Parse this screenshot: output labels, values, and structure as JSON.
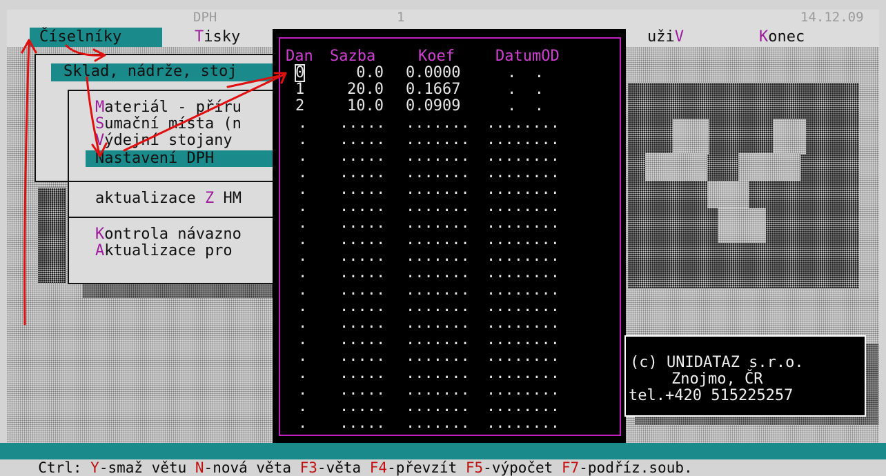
{
  "topbar": {
    "module": "DPH",
    "page": "1",
    "date": "14.12.09"
  },
  "menu": [
    {
      "hot": "",
      "label": "Číselníky",
      "selected": true
    },
    {
      "hot": "T",
      "label": "isky"
    },
    {
      "pre": "uži",
      "hot": "V",
      "label": ""
    },
    {
      "hot": "K",
      "label": "onec"
    }
  ],
  "submenu1": {
    "selected": "Sklad, nádrže, stoj"
  },
  "submenu2": {
    "items": [
      {
        "hot": "M",
        "label": "ateriál - příru"
      },
      {
        "hot": "S",
        "label": "umační místa (n"
      },
      {
        "hot": "V",
        "label": "ýdejní stojany"
      },
      {
        "hot": "",
        "label": "Nastavení DPH",
        "selected": true
      }
    ]
  },
  "submenu3": {
    "pre": "aktualizace ",
    "hot": "Z",
    "label": " HM"
  },
  "submenu4": {
    "items": [
      {
        "hot": "K",
        "label": "ontrola návazno"
      },
      {
        "hot": "A",
        "label": "ktualizace pro"
      }
    ]
  },
  "table": {
    "columns": [
      "Dan",
      "Sazba",
      "Koef",
      "DatumOD"
    ],
    "rows": [
      {
        "dan": "0",
        "sazba": "0.0",
        "koef": "0.0000",
        "datum": ".  ."
      },
      {
        "dan": "1",
        "sazba": "20.0",
        "koef": "0.1667",
        "datum": ".  ."
      },
      {
        "dan": "2",
        "sazba": "10.0",
        "koef": "0.0909",
        "datum": ".  ."
      }
    ],
    "empty_dan": ".",
    "empty_sazba": ".....",
    "empty_koef": ".......",
    "empty_datum": "........"
  },
  "copyright": {
    "line1": "(c) UNIDATAZ s.r.o.",
    "line2": "Znojmo, ČR",
    "line3": "tel.+420 515225257"
  },
  "statusbar": {
    "prefix": "Ctrl: ",
    "items": [
      {
        "key": "Y",
        "text": "-smaž větu "
      },
      {
        "key": "N",
        "text": "-nová věta "
      },
      {
        "key": "F3",
        "text": "-věta "
      },
      {
        "key": "F4",
        "text": "-převzít "
      },
      {
        "key": "F5",
        "text": "-výpočet "
      },
      {
        "key": "F7",
        "text": "-podříz.soub."
      }
    ]
  },
  "colors": {
    "accent_teal": "#1a8a8a",
    "hotkey_magenta": "#9c1c9c",
    "frame_magenta": "#c020c0",
    "annotation_red": "#e01010"
  }
}
